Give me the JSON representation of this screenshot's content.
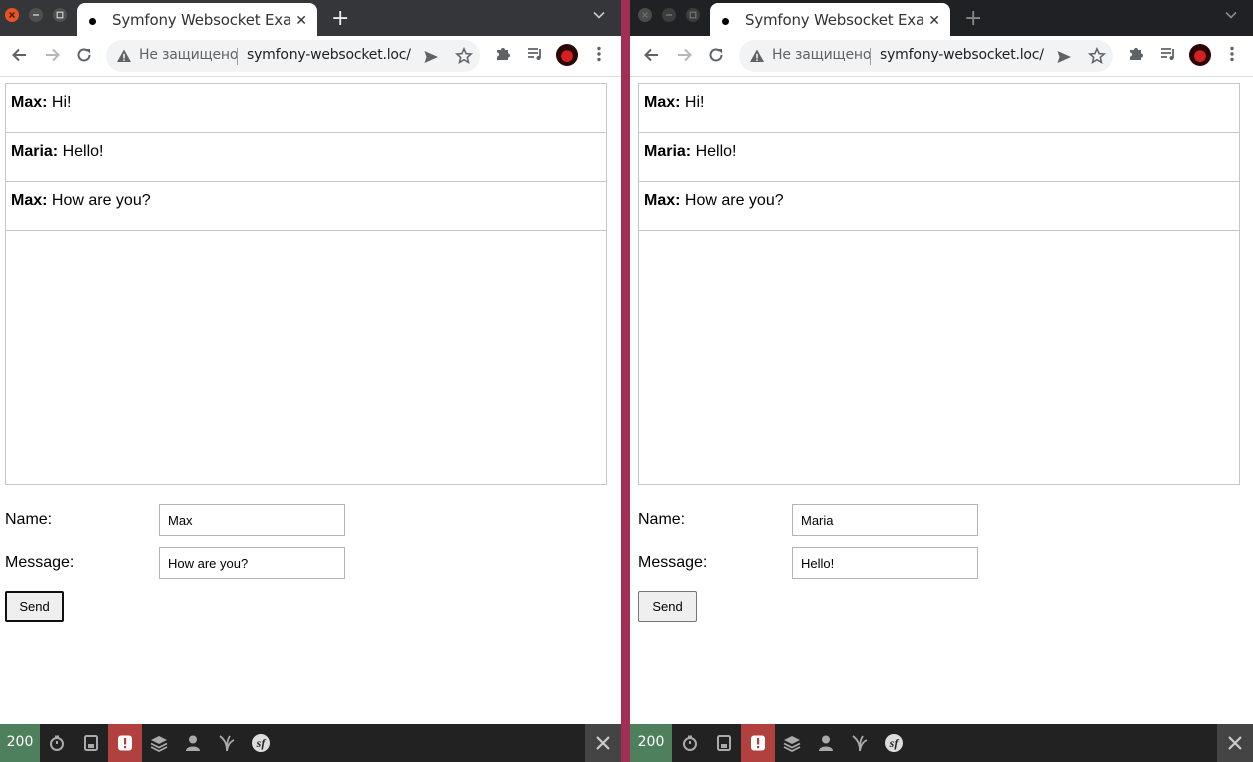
{
  "windows": [
    {
      "tab_title": "Symfony Websocket Example",
      "security_label": "Не защищено",
      "url": "symfony-websocket.loc/",
      "messages": [
        {
          "author": "Max:",
          "text": " Hi!"
        },
        {
          "author": "Maria:",
          "text": " Hello!"
        },
        {
          "author": "Max:",
          "text": " How are you?"
        }
      ],
      "form": {
        "name_label": "Name:",
        "name_value": "Max",
        "message_label": "Message:",
        "message_value": "How are you?",
        "send_label": "Send"
      },
      "toolbar": {
        "status_code": "200"
      }
    },
    {
      "tab_title": "Symfony Websocket Example",
      "security_label": "Не защищено",
      "url": "symfony-websocket.loc/",
      "messages": [
        {
          "author": "Max:",
          "text": " Hi!"
        },
        {
          "author": "Maria:",
          "text": " Hello!"
        },
        {
          "author": "Max:",
          "text": " How are you?"
        }
      ],
      "form": {
        "name_label": "Name:",
        "name_value": "Maria",
        "message_label": "Message:",
        "message_value": "Hello!",
        "send_label": "Send"
      },
      "toolbar": {
        "status_code": "200"
      }
    }
  ],
  "colors": {
    "desktop_divider": "#a12f55",
    "status_ok": "#4f805d",
    "error_panel": "#b0413e",
    "window_close": "#e95420"
  }
}
